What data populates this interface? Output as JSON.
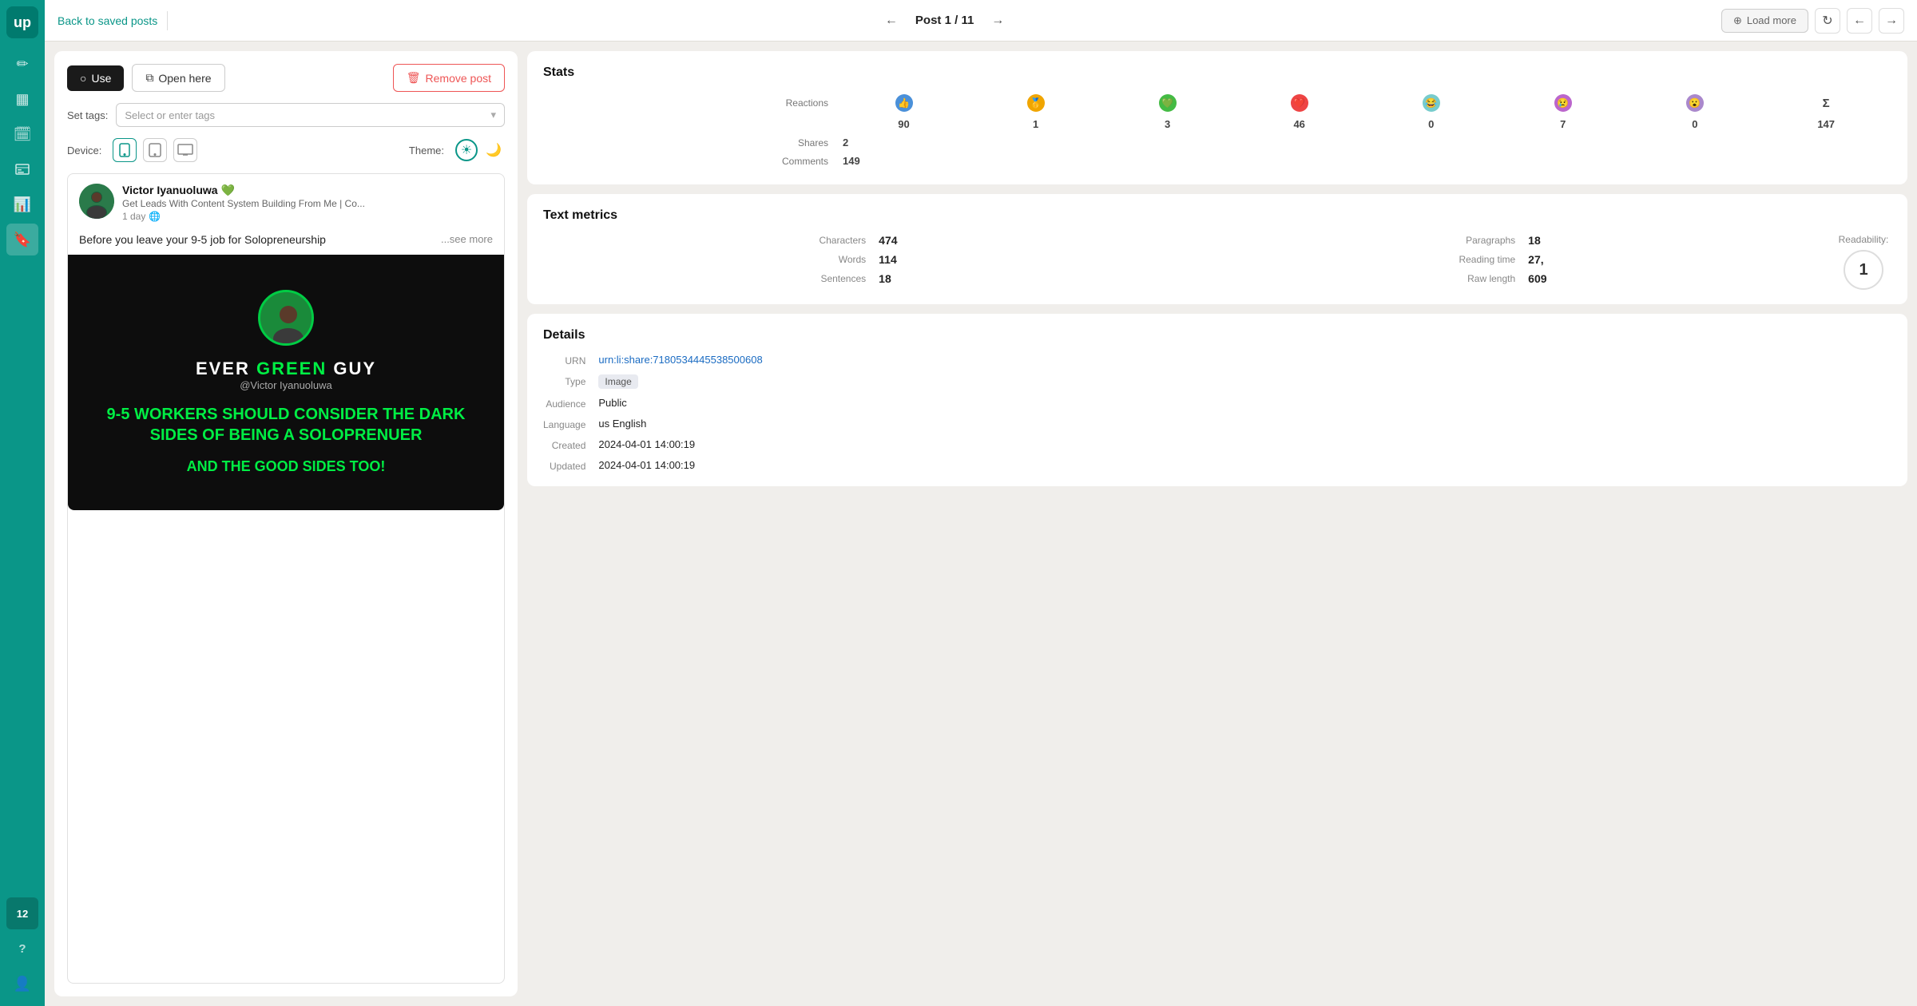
{
  "sidebar": {
    "logo": "up",
    "icons": [
      {
        "name": "edit-icon",
        "symbol": "✏",
        "active": false
      },
      {
        "name": "grid-icon",
        "symbol": "▦",
        "active": false
      },
      {
        "name": "calendar-icon",
        "symbol": "📅",
        "active": false
      },
      {
        "name": "inbox-icon",
        "symbol": "🗂",
        "active": false
      },
      {
        "name": "chart-icon",
        "symbol": "📈",
        "active": false
      },
      {
        "name": "bookmark-icon",
        "symbol": "🔖",
        "active": true
      }
    ],
    "badge_label": "12",
    "help_icon": "?",
    "profile_icon": "👤"
  },
  "topnav": {
    "back_label": "Back to saved posts",
    "post_counter": "Post 1 / 11",
    "load_more": "Load more",
    "prev_arrow": "←",
    "next_arrow": "→"
  },
  "toolbar": {
    "use_label": "Use",
    "open_here_label": "Open here",
    "remove_label": "Remove post"
  },
  "tags": {
    "label": "Set tags:",
    "placeholder": "Select or enter tags"
  },
  "device": {
    "label": "Device:",
    "theme_label": "Theme:"
  },
  "post": {
    "author_name": "Victor Iyanuoluwa",
    "author_subtitle": "Get Leads With Content System Building From Me | Co...",
    "post_time": "1 day",
    "post_text": "Before you leave your 9-5 job for Solopreneurship",
    "see_more": "...see more",
    "brand_name_white": "Ever",
    "brand_name_green": "Green",
    "brand_name_end": "Guy",
    "brand_handle": "@Victor Iyanuoluwa",
    "headline": "9-5 Workers should consider the dark sides of being a Soloprenuer",
    "subline": "And the good sides too!"
  },
  "stats": {
    "title": "Stats",
    "reactions_label": "Reactions",
    "reaction_icons": [
      "👍",
      "🥇",
      "💚",
      "❤️",
      "😂",
      "😢",
      "😮",
      "Σ"
    ],
    "reaction_colors": [
      "#4a90d9",
      "#f0a500",
      "#44bb44",
      "#ee4444",
      "#77cccc",
      "#bb66cc",
      "#aa88cc",
      "#333"
    ],
    "reaction_counts": [
      "90",
      "1",
      "3",
      "46",
      "0",
      "7",
      "0",
      "147"
    ],
    "shares_label": "Shares",
    "shares_value": "2",
    "comments_label": "Comments",
    "comments_value": "149"
  },
  "text_metrics": {
    "title": "Text metrics",
    "characters_label": "Characters",
    "characters_value": "474",
    "paragraphs_label": "Paragraphs",
    "paragraphs_value": "18",
    "readability_label": "Readability:",
    "readability_value": "1",
    "words_label": "Words",
    "words_value": "114",
    "reading_time_label": "Reading time",
    "reading_time_value": "27,",
    "sentences_label": "Sentences",
    "sentences_value": "18",
    "raw_length_label": "Raw length",
    "raw_length_value": "609"
  },
  "details": {
    "title": "Details",
    "urn_label": "URN",
    "urn_value": "urn:li:share:7180534445538500608",
    "type_label": "Type",
    "type_value": "Image",
    "audience_label": "Audience",
    "audience_value": "Public",
    "language_label": "Language",
    "language_value": "us English",
    "created_label": "Created",
    "created_value": "2024-04-01 14:00:19",
    "updated_label": "Updated",
    "updated_value": "2024-04-01 14:00:19"
  }
}
